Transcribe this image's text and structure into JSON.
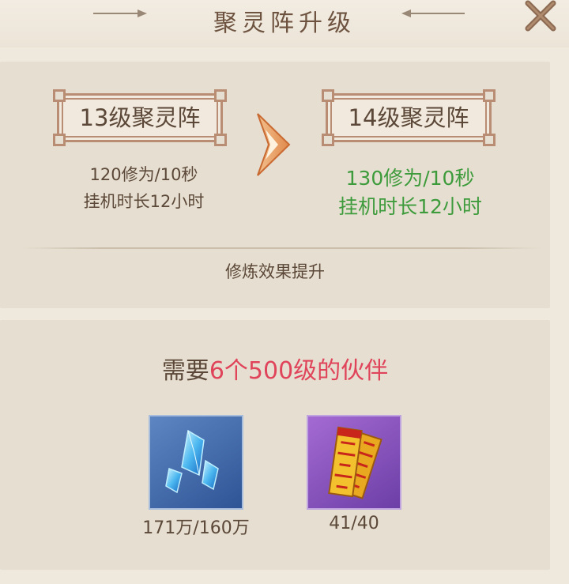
{
  "dialog": {
    "title": "聚灵阵升级"
  },
  "upgrade": {
    "current": {
      "level_label": "13级聚灵阵",
      "rate": "120修为/10秒",
      "idle_time": "挂机时长12小时"
    },
    "next": {
      "level_label": "14级聚灵阵",
      "rate": "130修为/10秒",
      "idle_time": "挂机时长12小时"
    },
    "effect_note": "修炼效果提升"
  },
  "requirement": {
    "prefix": "需要",
    "highlight": "6个500级的伙伴"
  },
  "materials": [
    {
      "icon": "blue-crystal-icon",
      "count": "171万/160万"
    },
    {
      "icon": "talisman-scroll-icon",
      "count": "41/40"
    }
  ],
  "colors": {
    "background": "#efe8dc",
    "panel": "#e6dfd1",
    "text": "#5c4838",
    "upgrade_green": "#3e9b3c",
    "highlight_red": "#e0445a",
    "frame": "#b88d74"
  }
}
